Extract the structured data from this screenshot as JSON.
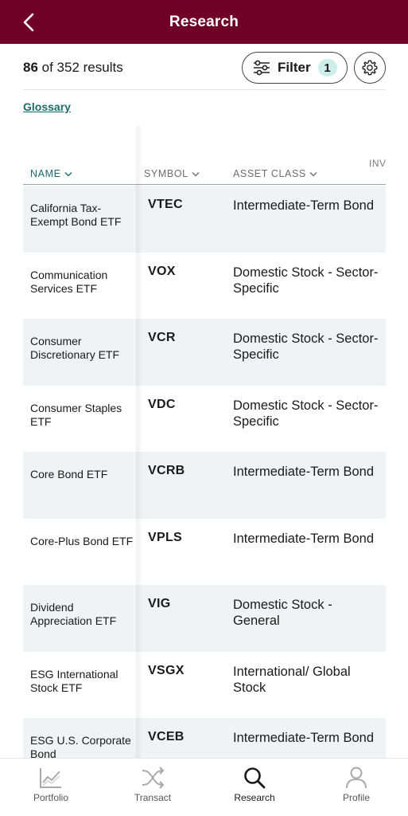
{
  "header": {
    "title": "Research",
    "back_icon": "chevron-left-icon"
  },
  "results": {
    "count": "86",
    "of_total": " of 352 results"
  },
  "filter": {
    "label": "Filter",
    "badge": "1",
    "icon": "sliders-icon"
  },
  "settings": {
    "icon": "gear-icon"
  },
  "glossary": {
    "label": "Glossary"
  },
  "table": {
    "columns": {
      "name": "NAME",
      "symbol": "SYMBOL",
      "asset_class": "ASSET CLASS",
      "partial": "INV"
    },
    "rows": [
      {
        "name": "California Tax-Exempt Bond ETF",
        "symbol": "VTEC",
        "asset_class": "Intermediate-Term Bond"
      },
      {
        "name": "Communication Services ETF",
        "symbol": "VOX",
        "asset_class": "Domestic Stock - Sector-Specific"
      },
      {
        "name": "Consumer Discretionary ETF",
        "symbol": "VCR",
        "asset_class": "Domestic Stock - Sector-Specific"
      },
      {
        "name": "Consumer Staples ETF",
        "symbol": "VDC",
        "asset_class": "Domestic Stock - Sector-Specific"
      },
      {
        "name": "Core Bond ETF",
        "symbol": "VCRB",
        "asset_class": "Intermediate-Term Bond"
      },
      {
        "name": "Core-Plus Bond ETF",
        "symbol": "VPLS",
        "asset_class": "Intermediate-Term Bond"
      },
      {
        "name": "Dividend Appreciation ETF",
        "symbol": "VIG",
        "asset_class": "Domestic Stock - General"
      },
      {
        "name": "ESG International Stock ETF",
        "symbol": "VSGX",
        "asset_class": "International/ Global Stock"
      },
      {
        "name": "ESG U.S. Corporate Bond",
        "symbol": "VCEB",
        "asset_class": "Intermediate-Term Bond"
      }
    ]
  },
  "bottom_nav": [
    {
      "label": "Portfolio",
      "icon": "portfolio-chart-icon"
    },
    {
      "label": "Transact",
      "icon": "transact-arrows-icon"
    },
    {
      "label": "Research",
      "icon": "search-icon",
      "active": true
    },
    {
      "label": "Profile",
      "icon": "person-icon"
    }
  ],
  "colors": {
    "header_bg": "#6f0026",
    "accent_teal": "#1b6b6b",
    "badge_bg": "#cdeee9",
    "row_shade": "#eff3f5"
  }
}
